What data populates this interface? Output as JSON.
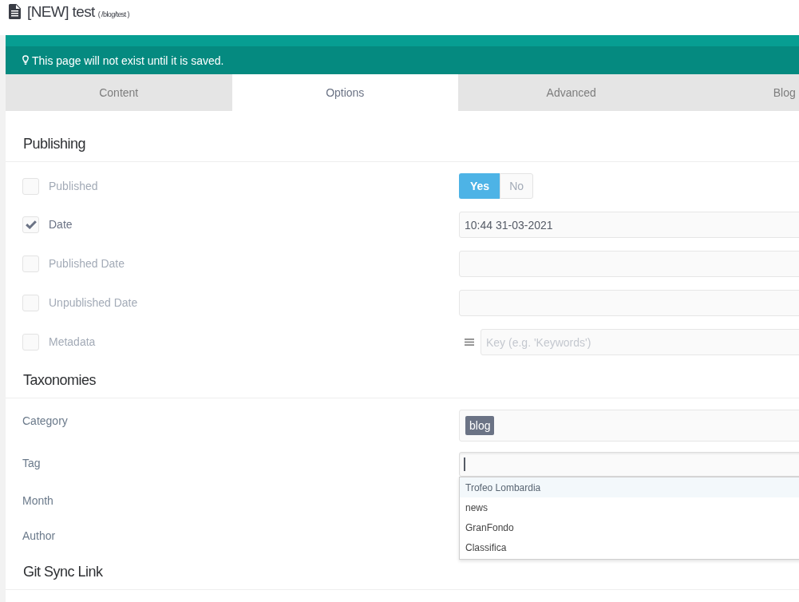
{
  "header": {
    "title": "[NEW] test",
    "route": "( /blog/test )"
  },
  "notice": {
    "text": "This page will not exist until it is saved."
  },
  "tabs": [
    {
      "label": "Content",
      "selected": false
    },
    {
      "label": "Options",
      "selected": true
    },
    {
      "label": "Advanced",
      "selected": false
    },
    {
      "label": "Blog",
      "selected": false
    }
  ],
  "sections": [
    {
      "title": "Publishing",
      "rows": [
        {
          "label": "Published",
          "checked": false,
          "kind": "toggle",
          "options": [
            {
              "label": "Yes",
              "selected": true
            },
            {
              "label": "No",
              "selected": false
            }
          ]
        },
        {
          "label": "Date",
          "checked": true,
          "kind": "input",
          "value": "10:44 31-03-2021"
        },
        {
          "label": "Published Date",
          "checked": false,
          "kind": "input"
        },
        {
          "label": "Unpublished Date",
          "checked": false,
          "kind": "input"
        },
        {
          "label": "Metadata",
          "checked": false,
          "kind": "keyvalue",
          "placeholder": "Key (e.g. 'Keywords')"
        }
      ]
    },
    {
      "title": "Taxonomies",
      "rows": [
        {
          "label": "Category",
          "kind": "tags",
          "tags": [
            "blog"
          ]
        },
        {
          "label": "Tag",
          "kind": "combo",
          "focused": true,
          "suggestions": [
            {
              "label": "Trofeo Lombardia",
              "selected": true
            },
            {
              "label": "news",
              "selected": false
            },
            {
              "label": "GranFondo",
              "selected": false
            },
            {
              "label": "Classifica",
              "selected": false
            }
          ]
        },
        {
          "label": "Month"
        },
        {
          "label": "Author"
        }
      ]
    },
    {
      "title": "Git Sync Link"
    }
  ]
}
